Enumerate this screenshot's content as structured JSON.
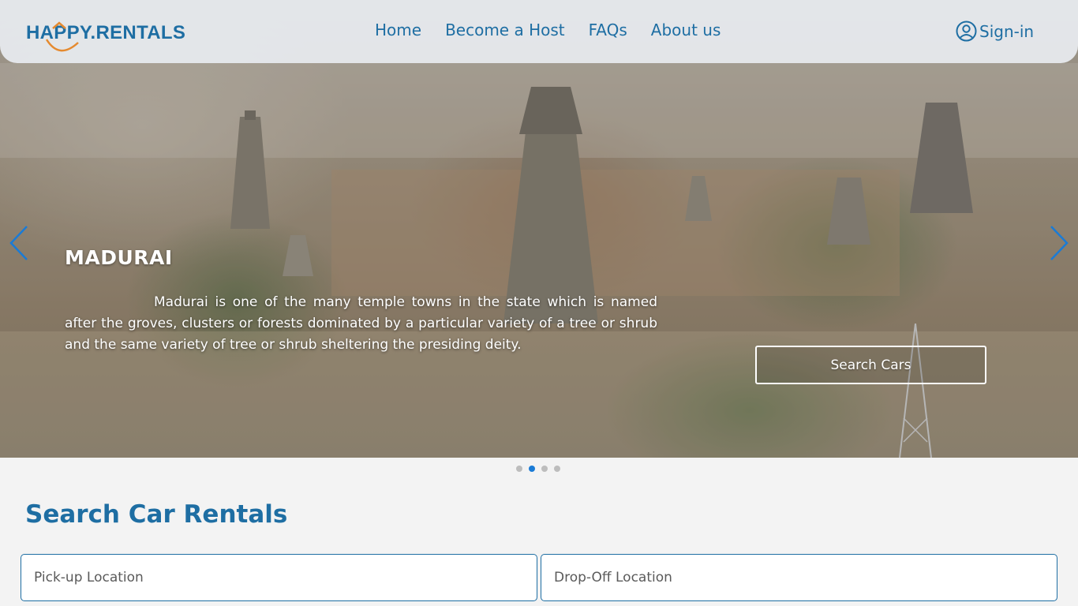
{
  "brand": {
    "logo_text": "HAPPY.RENTALS",
    "primary_color": "#1e6ea3",
    "accent_color": "#e58a2f"
  },
  "nav": {
    "links": [
      {
        "label": "Home"
      },
      {
        "label": "Become a Host"
      },
      {
        "label": "FAQs"
      },
      {
        "label": "About us"
      }
    ],
    "signin_label": "Sign-in",
    "signin_icon": "user-circle-icon"
  },
  "hero": {
    "city": "MADURAI",
    "description": "Madurai is one of the many temple towns in the state which is named after the groves, clusters or forests dominated by a particular variety of a tree or shrub and the same variety of tree or shrub sheltering the presiding deity.",
    "cta_label": "Search Cars",
    "prev_icon": "chevron-left-icon",
    "next_icon": "chevron-right-icon"
  },
  "carousel": {
    "slide_count": 4,
    "active_index": 1,
    "active_color": "#1a7bd6"
  },
  "search": {
    "title": "Search Car Rentals",
    "pickup_placeholder": "Pick-up Location",
    "dropoff_placeholder": "Drop-Off Location"
  }
}
